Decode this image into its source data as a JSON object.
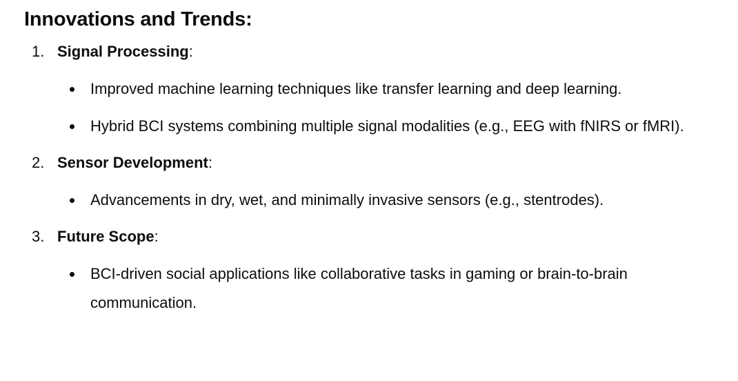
{
  "heading": "Innovations and Trends:",
  "sections": [
    {
      "number": "1.",
      "title": "Signal Processing",
      "suffix": ":",
      "bullets": [
        "Improved machine learning techniques like transfer learning and deep learning.",
        "Hybrid BCI systems combining multiple signal modalities (e.g., EEG with fNIRS or fMRI)."
      ]
    },
    {
      "number": "2.",
      "title": "Sensor Development",
      "suffix": ":",
      "bullets": [
        "Advancements in dry, wet, and minimally invasive sensors (e.g., stentrodes)."
      ]
    },
    {
      "number": "3.",
      "title": "Future Scope",
      "suffix": ":",
      "bullets": [
        "BCI-driven social applications like collaborative tasks in gaming or brain-to-brain communication."
      ]
    }
  ]
}
